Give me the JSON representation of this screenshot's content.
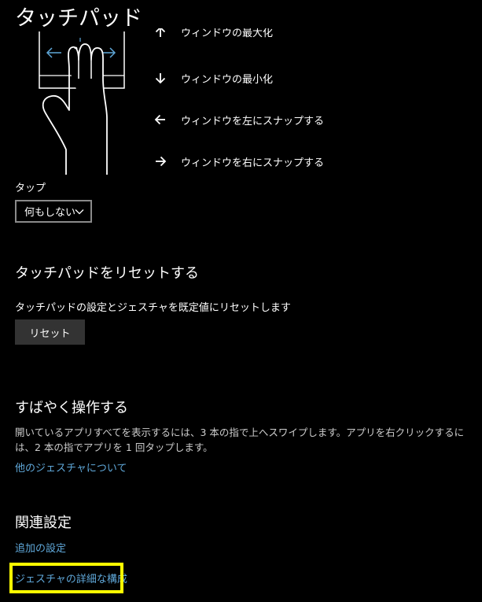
{
  "page": {
    "title": "タッチパッド"
  },
  "gestures": {
    "items": [
      {
        "icon": "arrow-up-icon",
        "label": "ウィンドウの最大化"
      },
      {
        "icon": "arrow-down-icon",
        "label": "ウィンドウの最小化"
      },
      {
        "icon": "arrow-left-icon",
        "label": "ウィンドウを左にスナップする"
      },
      {
        "icon": "arrow-right-icon",
        "label": "ウィンドウを右にスナップする"
      }
    ]
  },
  "tap": {
    "label": "タップ",
    "selected": "何もしない"
  },
  "reset": {
    "heading": "タッチパッドをリセットする",
    "description": "タッチパッドの設定とジェスチャを既定値にリセットします",
    "button_label": "リセット"
  },
  "quick": {
    "heading": "すばやく操作する",
    "description": "開いているアプリすべてを表示するには、3 本の指で上へスワイプします。アプリを右クリックするには、2 本の指でアプリを 1 回タップします。",
    "link": "他のジェスチャについて"
  },
  "related": {
    "heading": "関連設定",
    "links": [
      "追加の設定",
      "ジェスチャの詳細な構成"
    ]
  },
  "colors": {
    "background": "#000000",
    "link": "#5fa7d8",
    "button": "#333333",
    "highlight": "#ffff00"
  }
}
